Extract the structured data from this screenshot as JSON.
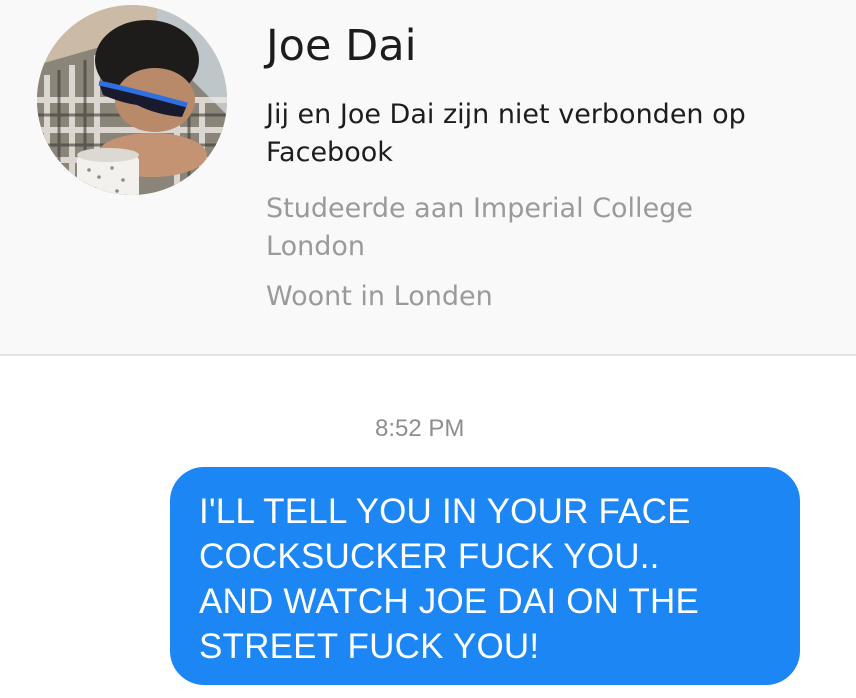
{
  "profile": {
    "avatar_icon": "profile-photo",
    "name": "Joe Dai",
    "connection_status": "Jij en Joe Dai zijn niet verbonden op Facebook",
    "education": "Studeerde aan Imperial College London",
    "location": "Woont in Londen"
  },
  "conversation": {
    "timestamp": "8:52 PM",
    "messages": [
      {
        "direction": "outgoing",
        "text": "I'LL TELL YOU IN YOUR FACE\nCOCKSUCKER FUCK YOU..\nAND WATCH JOE DAI ON THE\nSTREET FUCK YOU!"
      }
    ]
  },
  "colors": {
    "bubble": "#1b86f4",
    "header_bg": "#f9f9f9",
    "secondary_text": "#9a9a9a"
  }
}
